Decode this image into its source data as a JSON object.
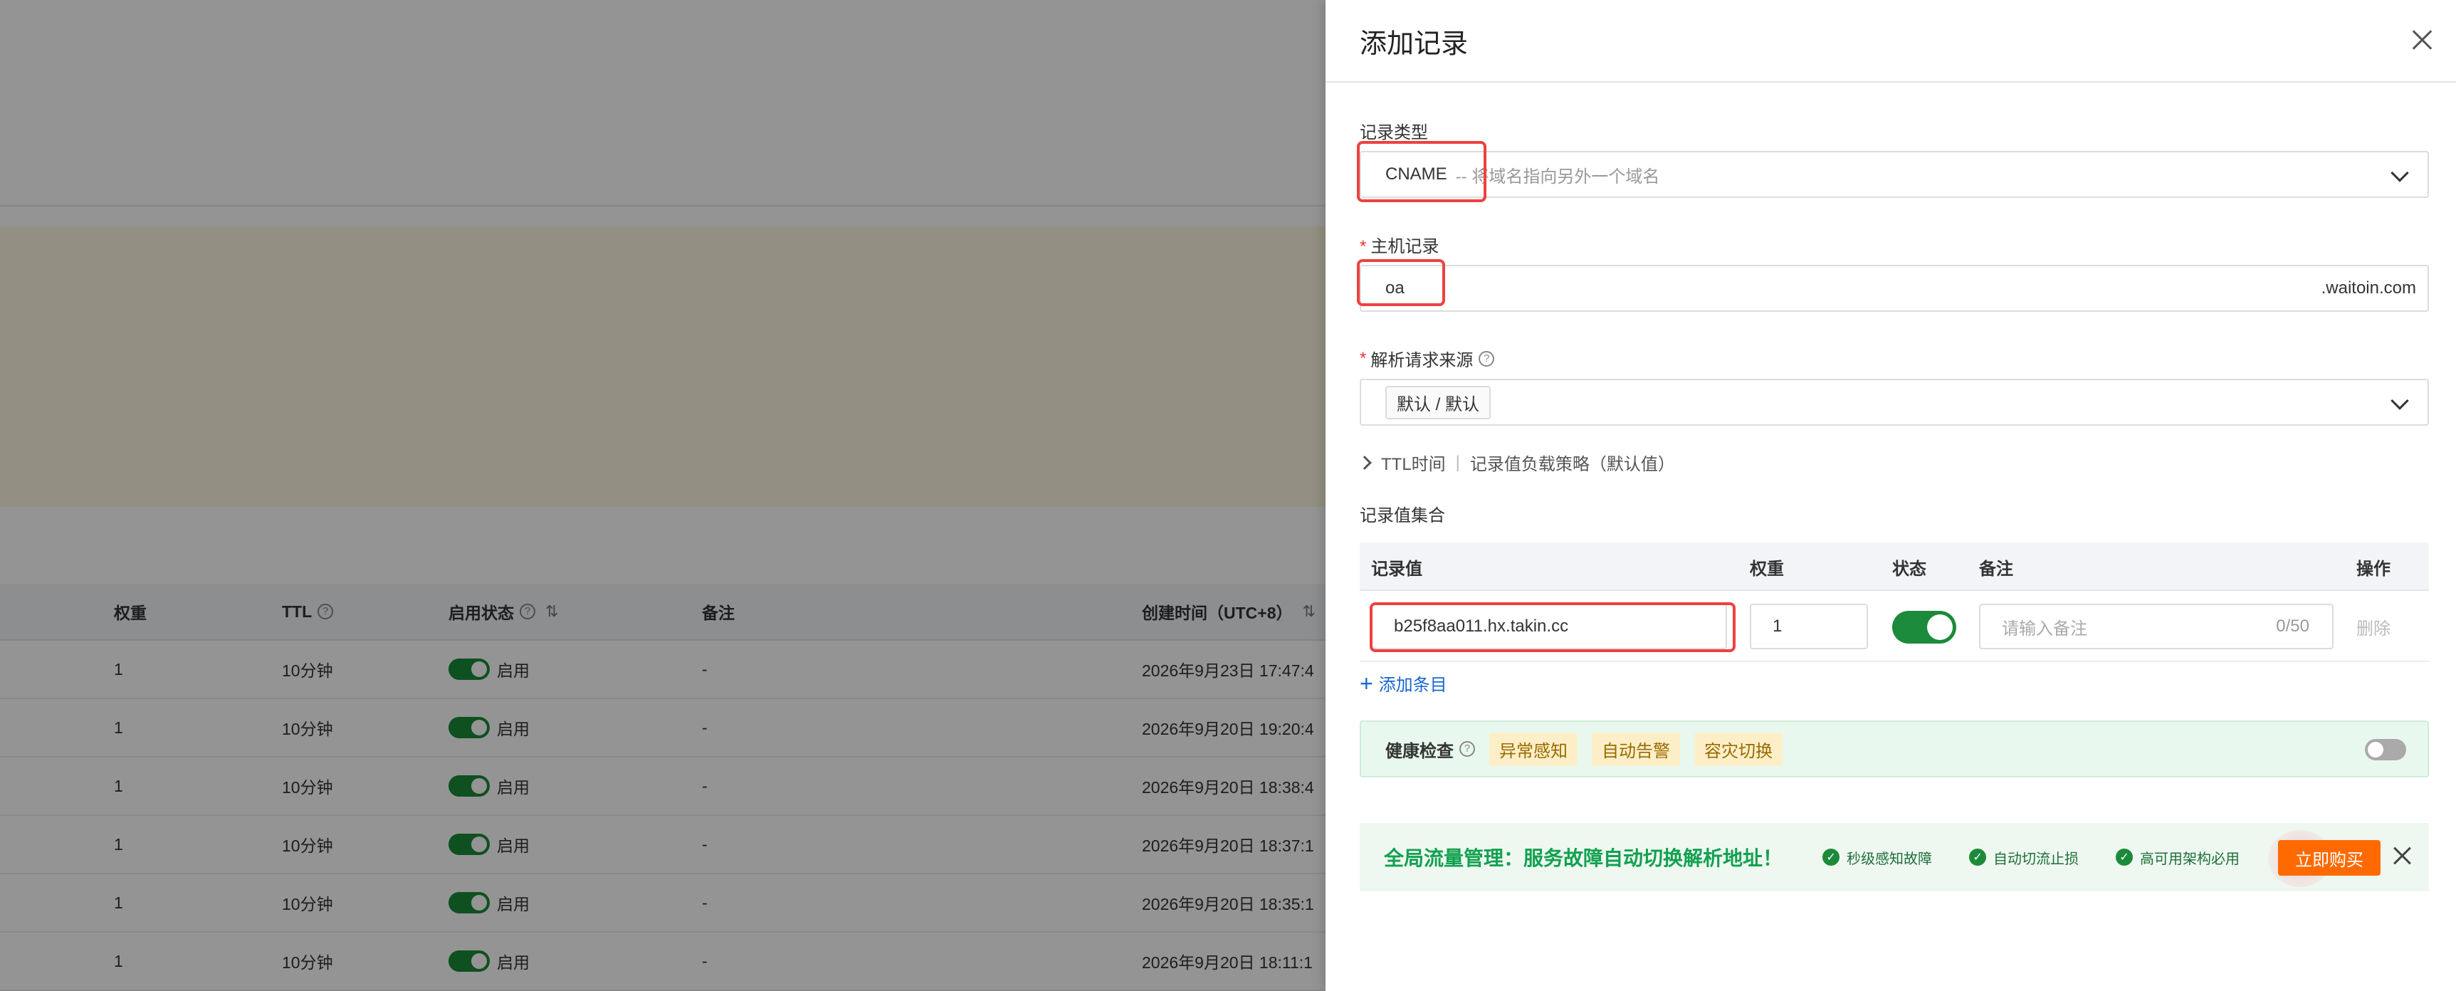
{
  "background_table": {
    "headers": {
      "weight": "权重",
      "ttl": "TTL",
      "state": "启用状态",
      "note": "备注",
      "created": "创建时间（UTC+8）"
    },
    "rows": [
      {
        "weight": "1",
        "ttl": "10分钟",
        "state": "启用",
        "note": "-",
        "created": "2026年9月23日 17:47:4"
      },
      {
        "weight": "1",
        "ttl": "10分钟",
        "state": "启用",
        "note": "-",
        "created": "2026年9月20日 19:20:4"
      },
      {
        "weight": "1",
        "ttl": "10分钟",
        "state": "启用",
        "note": "-",
        "created": "2026年9月20日 18:38:4"
      },
      {
        "weight": "1",
        "ttl": "10分钟",
        "state": "启用",
        "note": "-",
        "created": "2026年9月20日 18:37:1"
      },
      {
        "weight": "1",
        "ttl": "10分钟",
        "state": "启用",
        "note": "-",
        "created": "2026年9月20日 18:35:1"
      },
      {
        "weight": "1",
        "ttl": "10分钟",
        "state": "启用",
        "note": "-",
        "created": "2026年9月20日 18:11:1"
      }
    ]
  },
  "drawer": {
    "title": "添加记录",
    "record_type": {
      "label": "记录类型",
      "value": "CNAME",
      "hint": "-- 将域名指向另外一个域名"
    },
    "host_record": {
      "label": "主机记录",
      "value": "oa",
      "suffix": ".waitoin.com"
    },
    "source": {
      "label": "解析请求来源",
      "value": "默认 / 默认"
    },
    "ttl_line": {
      "ttl": "TTL时间",
      "policy": "记录值负载策略（默认值）"
    },
    "value_set": {
      "label": "记录值集合",
      "headers": {
        "value": "记录值",
        "weight": "权重",
        "state": "状态",
        "note": "备注",
        "action": "操作"
      },
      "row": {
        "value": "b25f8aa011.hx.takin.cc",
        "weight": "1",
        "note_placeholder": "请输入备注",
        "counter": "0/50",
        "delete": "删除"
      },
      "add_item": "添加条目"
    },
    "health": {
      "label": "健康检查",
      "tags": [
        "异常感知",
        "自动告警",
        "容灾切换"
      ]
    },
    "promo": {
      "title": "全局流量管理：服务故障自动切换解析地址！",
      "features": [
        "秒级感知故障",
        "自动切流止损",
        "高可用架构必用"
      ],
      "buy": "立即购买"
    }
  },
  "colors": {
    "accent_green": "#1b8a3a",
    "link_blue": "#1966d1",
    "highlight_red": "#ec4141",
    "buy_orange": "#ff6a00"
  }
}
